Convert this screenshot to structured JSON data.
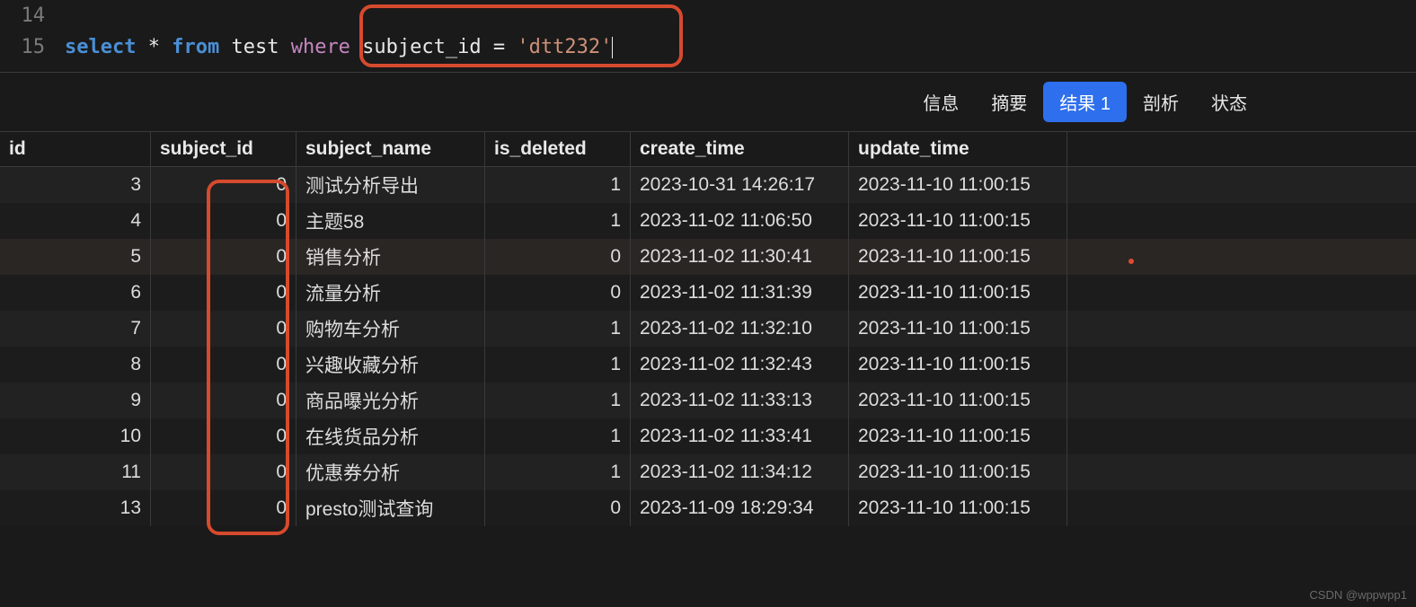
{
  "editor": {
    "lines": [
      {
        "num": "14",
        "tokens": []
      },
      {
        "num": "15",
        "tokens": [
          {
            "t": "select",
            "c": "kw1"
          },
          {
            "t": " ",
            "c": "plain"
          },
          {
            "t": "*",
            "c": "plain"
          },
          {
            "t": " ",
            "c": "plain"
          },
          {
            "t": "from",
            "c": "kw2"
          },
          {
            "t": " ",
            "c": "plain"
          },
          {
            "t": "test ",
            "c": "plain"
          },
          {
            "t": "where",
            "c": "kw3"
          },
          {
            "t": " subject_id ",
            "c": "plain"
          },
          {
            "t": "=",
            "c": "plain"
          },
          {
            "t": " ",
            "c": "plain"
          },
          {
            "t": "'dtt232'",
            "c": "str"
          }
        ]
      }
    ]
  },
  "tabs": [
    {
      "label": "信息",
      "active": false
    },
    {
      "label": "摘要",
      "active": false
    },
    {
      "label": "结果 1",
      "active": true
    },
    {
      "label": "剖析",
      "active": false
    },
    {
      "label": "状态",
      "active": false
    }
  ],
  "columns": [
    "id",
    "subject_id",
    "subject_name",
    "is_deleted",
    "create_time",
    "update_time"
  ],
  "rows": [
    {
      "id": "3",
      "subject_id": "0",
      "subject_name": "测试分析导出",
      "is_deleted": "1",
      "create_time": "2023-10-31 14:26:17",
      "update_time": "2023-11-10 11:00:15"
    },
    {
      "id": "4",
      "subject_id": "0",
      "subject_name": "主题58",
      "is_deleted": "1",
      "create_time": "2023-11-02 11:06:50",
      "update_time": "2023-11-10 11:00:15"
    },
    {
      "id": "5",
      "subject_id": "0",
      "subject_name": "销售分析",
      "is_deleted": "0",
      "create_time": "2023-11-02 11:30:41",
      "update_time": "2023-11-10 11:00:15"
    },
    {
      "id": "6",
      "subject_id": "0",
      "subject_name": "流量分析",
      "is_deleted": "0",
      "create_time": "2023-11-02 11:31:39",
      "update_time": "2023-11-10 11:00:15"
    },
    {
      "id": "7",
      "subject_id": "0",
      "subject_name": "购物车分析",
      "is_deleted": "1",
      "create_time": "2023-11-02 11:32:10",
      "update_time": "2023-11-10 11:00:15"
    },
    {
      "id": "8",
      "subject_id": "0",
      "subject_name": "兴趣收藏分析",
      "is_deleted": "1",
      "create_time": "2023-11-02 11:32:43",
      "update_time": "2023-11-10 11:00:15"
    },
    {
      "id": "9",
      "subject_id": "0",
      "subject_name": "商品曝光分析",
      "is_deleted": "1",
      "create_time": "2023-11-02 11:33:13",
      "update_time": "2023-11-10 11:00:15"
    },
    {
      "id": "10",
      "subject_id": "0",
      "subject_name": "在线货品分析",
      "is_deleted": "1",
      "create_time": "2023-11-02 11:33:41",
      "update_time": "2023-11-10 11:00:15"
    },
    {
      "id": "11",
      "subject_id": "0",
      "subject_name": "优惠券分析",
      "is_deleted": "1",
      "create_time": "2023-11-02 11:34:12",
      "update_time": "2023-11-10 11:00:15"
    },
    {
      "id": "13",
      "subject_id": "0",
      "subject_name": "presto测试查询",
      "is_deleted": "0",
      "create_time": "2023-11-09 18:29:34",
      "update_time": "2023-11-10 11:00:15"
    }
  ],
  "watermark": "CSDN @wppwpp1",
  "colors": {
    "accent": "#2d6fed",
    "highlight": "#d64a2e"
  }
}
